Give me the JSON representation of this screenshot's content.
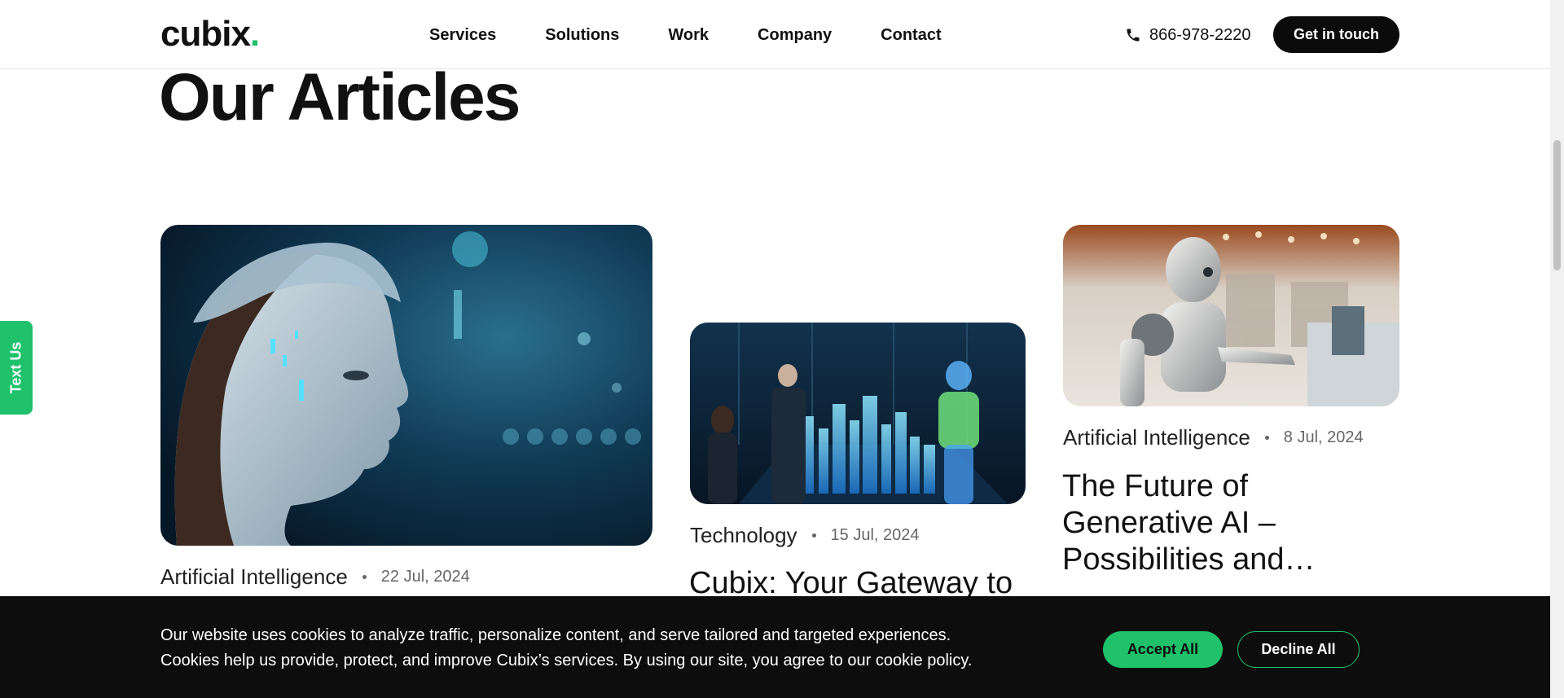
{
  "header": {
    "logo_text": "cubix",
    "logo_dot": ".",
    "nav": [
      {
        "label": "Services"
      },
      {
        "label": "Solutions"
      },
      {
        "label": "Work"
      },
      {
        "label": "Company"
      },
      {
        "label": "Contact"
      }
    ],
    "phone": "866-978-2220",
    "phone_icon": "phone-icon",
    "cta_label": "Get in touch"
  },
  "page": {
    "title": "Our Articles"
  },
  "side_tab": {
    "label": "Text Us"
  },
  "articles": [
    {
      "image": "ai-robot-woman-face",
      "category": "Artificial Intelligence",
      "date": "22 Jul, 2024",
      "title": ""
    },
    {
      "image": "hologram-city-meeting",
      "category": "Technology",
      "date": "15 Jul, 2024",
      "title": "Cubix: Your Gateway to"
    },
    {
      "image": "robot-at-store-counter",
      "category": "Artificial Intelligence",
      "date": "8 Jul, 2024",
      "title": "The Future of Generative AI – Possibilities and…"
    }
  ],
  "cookie": {
    "line1": "Our website uses cookies to analyze traffic, personalize content, and serve tailored and targeted experiences.",
    "line2": "Cookies help us provide, protect, and improve Cubix’s services. By using our site, you agree to our cookie policy.",
    "accept_label": "Accept All",
    "decline_label": "Decline All"
  },
  "colors": {
    "accent": "#1fc16b",
    "dark": "#0b0b0b"
  }
}
